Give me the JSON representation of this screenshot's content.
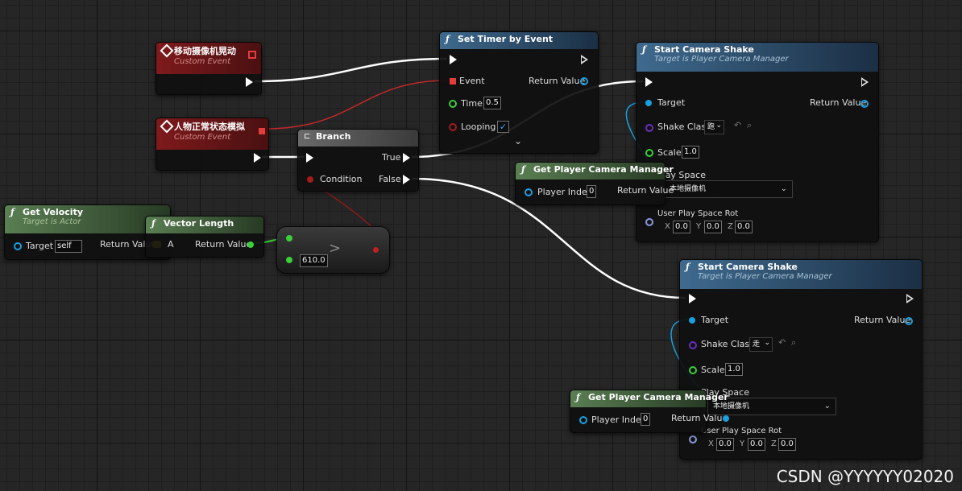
{
  "nodes": {
    "event_move": {
      "title": "移动摄像机晃动",
      "subtitle": "Custom Event"
    },
    "event_normal": {
      "title": "人物正常状态模拟",
      "subtitle": "Custom Event"
    },
    "set_timer": {
      "title": "Set Timer by Event",
      "event": "Event",
      "return_value": "Return Value",
      "time": "Time",
      "time_value": "0.5",
      "looping": "Looping",
      "check": "✓",
      "expand": "⌄"
    },
    "branch": {
      "title": "Branch",
      "condition": "Condition",
      "true": "True",
      "false": "False"
    },
    "get_velocity": {
      "title": "Get Velocity",
      "subtitle": "Target is Actor",
      "target": "Target",
      "target_value": "self",
      "return_value": "Return Value"
    },
    "vector_length": {
      "title": "Vector Length",
      "a": "A",
      "return_value": "Return Value"
    },
    "compare": {
      "op": ">",
      "value": "610.0"
    },
    "shake1": {
      "title": "Start Camera Shake",
      "subtitle": "Target is Player Camera Manager",
      "target": "Target",
      "return_value": "Return Value",
      "shake_class": "Shake Class",
      "shake_value": "跑",
      "scale": "Scale",
      "scale_value": "1.0",
      "play_space": "Play Space",
      "play_space_value": "本地摄像机",
      "rot": "User Play Space Rot",
      "x_label": "X",
      "x": "0.0",
      "y_label": "Y",
      "y": "0.0",
      "z_label": "Z",
      "z": "0.0"
    },
    "pcm1": {
      "title": "Get Player Camera Manager",
      "player_index": "Player Index",
      "index_value": "0",
      "return_value": "Return Value"
    },
    "shake2": {
      "title": "Start Camera Shake",
      "subtitle": "Target is Player Camera Manager",
      "target": "Target",
      "return_value": "Return Value",
      "shake_class": "Shake Class",
      "shake_value": "走",
      "scale": "Scale",
      "scale_value": "1.0",
      "play_space": "Play Space",
      "play_space_value": "本地摄像机",
      "rot": "User Play Space Rot",
      "x_label": "X",
      "x": "0.0",
      "y_label": "Y",
      "y": "0.0",
      "z_label": "Z",
      "z": "0.0"
    },
    "pcm2": {
      "title": "Get Player Camera Manager",
      "player_index": "Player Index",
      "index_value": "0",
      "return_value": "Return Value"
    }
  },
  "icons": {
    "func": "ƒ",
    "dropdown": "⌄",
    "reset": "↶",
    "search": "⌕"
  },
  "watermark": "CSDN @YYYYYY02020",
  "colors": {
    "exec": "#ffffff",
    "event_delegate": "#e23c3c",
    "object": "#1aa0e0",
    "float": "#3ad03a",
    "bool": "#a41c1c",
    "class": "#6a2fc0",
    "vector": "#f6c626",
    "rotator": "#8a9adf"
  }
}
